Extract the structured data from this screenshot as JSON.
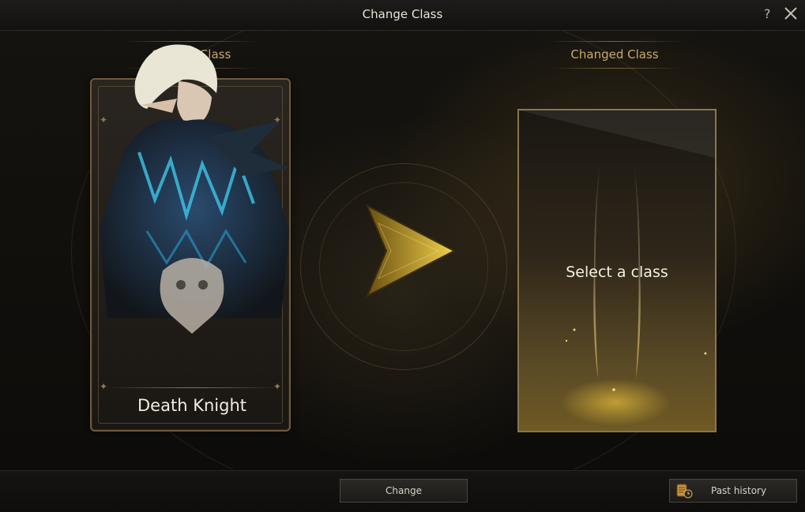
{
  "window": {
    "title": "Change Class",
    "help_label": "?"
  },
  "current": {
    "label": "Current Class",
    "class_name": "Death Knight"
  },
  "target": {
    "label": "Changed Class",
    "placeholder": "Select a class"
  },
  "footer": {
    "change_label": "Change",
    "history_label": "Past history"
  },
  "colors": {
    "accent_gold": "#c9a86a",
    "frame": "#6f5a3a",
    "arrow": "#e2c13a"
  },
  "icons": {
    "close": "close-icon",
    "help": "help-icon",
    "arrow": "arrow-right-icon",
    "history": "scroll-history-icon"
  }
}
